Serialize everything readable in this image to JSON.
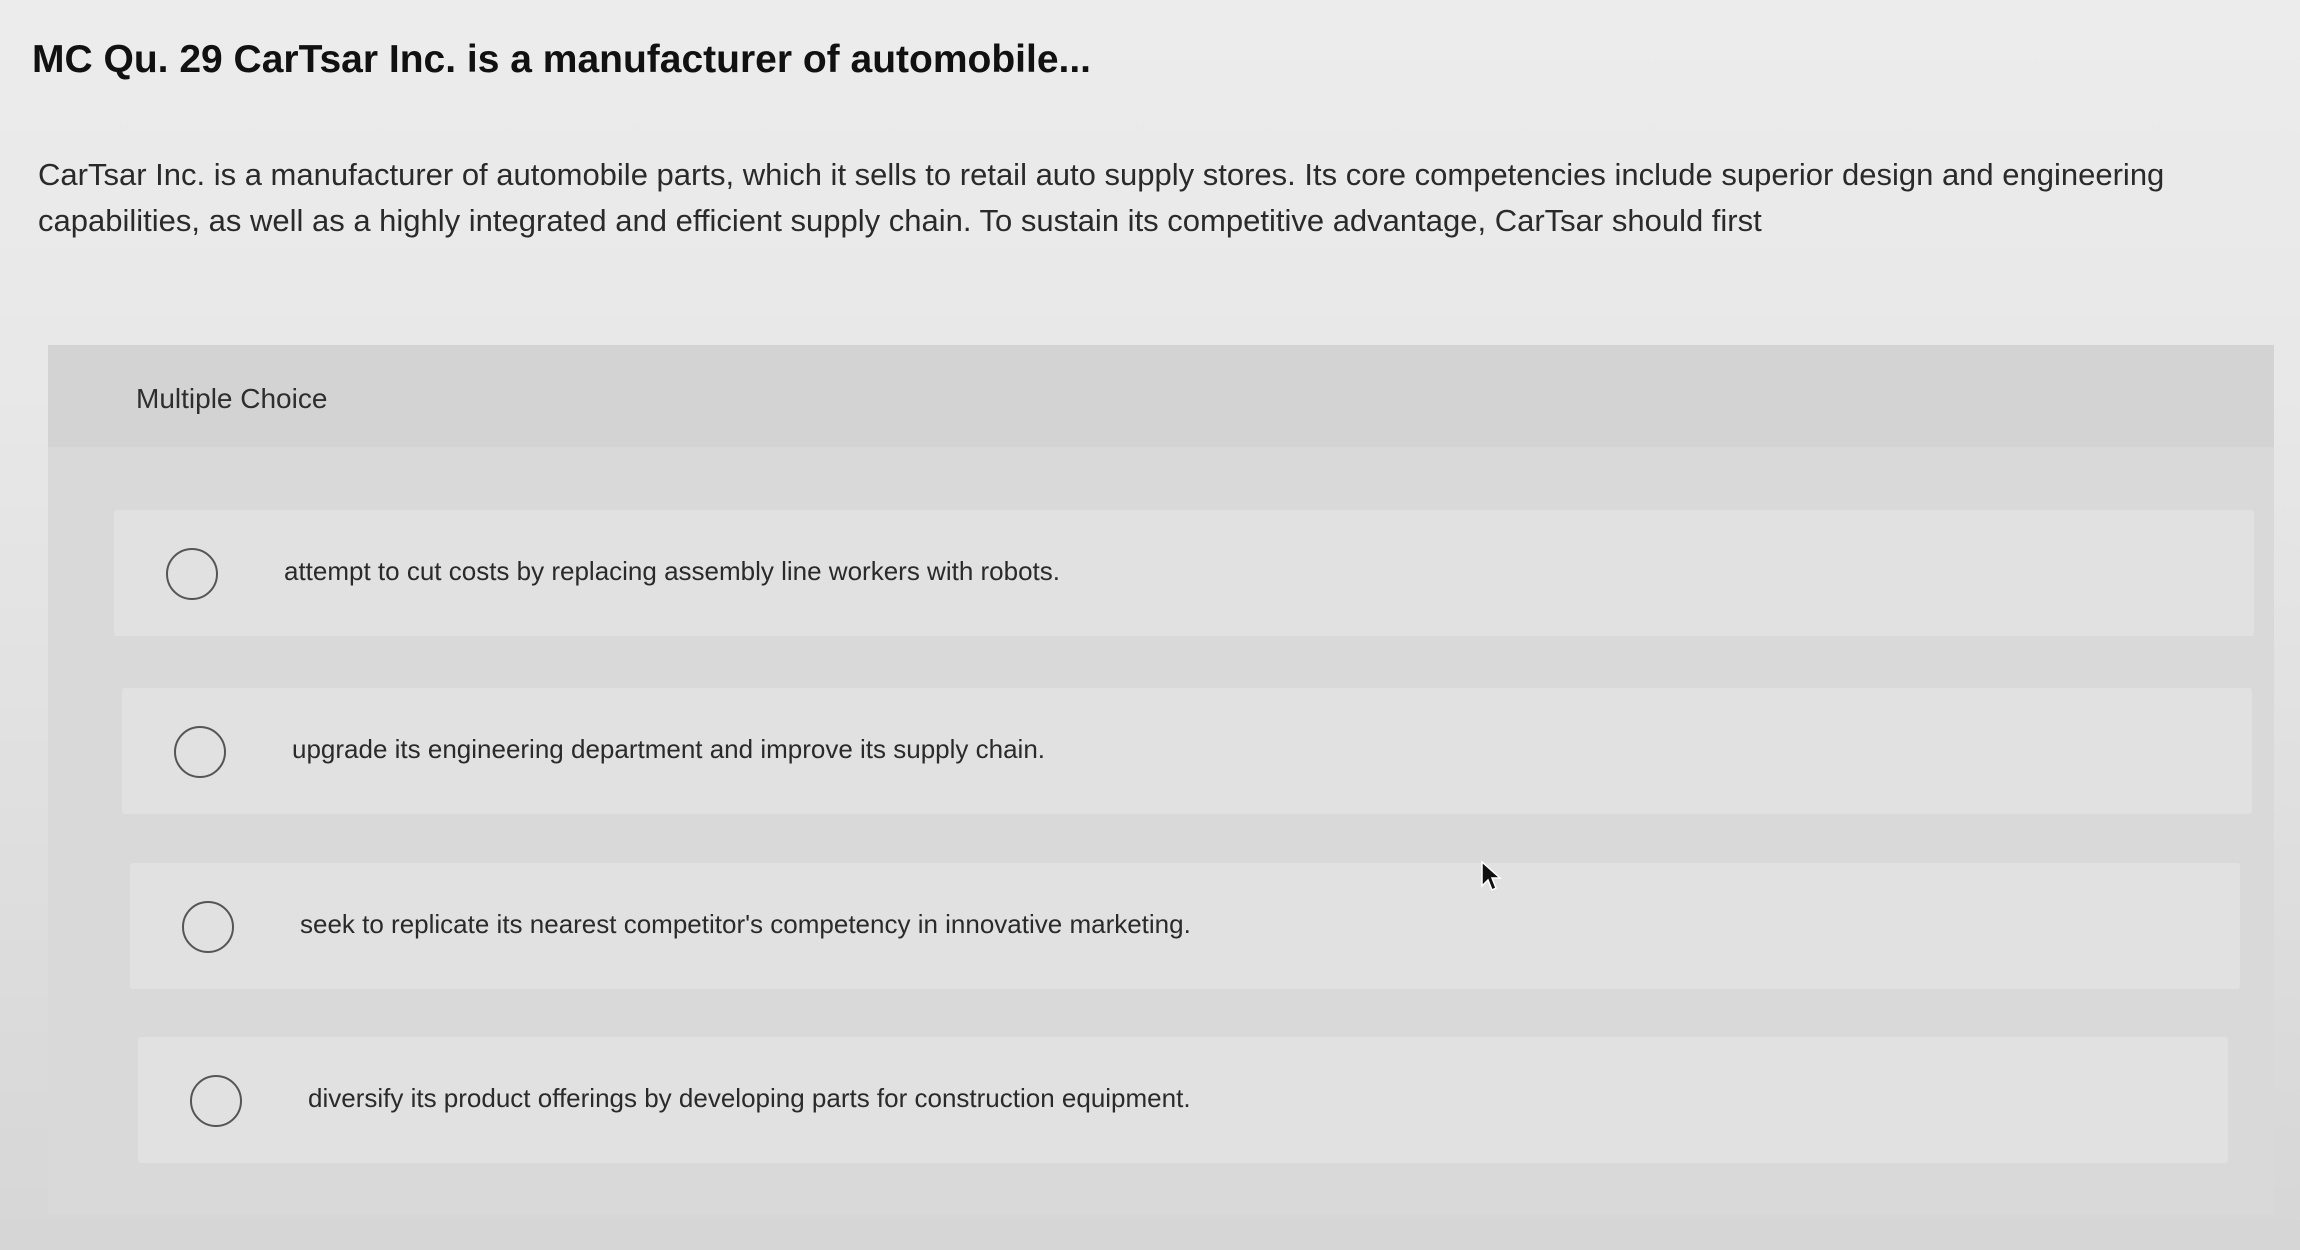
{
  "question": {
    "title": "MC Qu. 29 CarTsar Inc. is a manufacturer of automobile...",
    "body": "CarTsar Inc. is a manufacturer of automobile parts, which it sells to retail auto supply stores. Its core competencies include superior design and engineering capabilities, as well as a highly integrated and efficient supply chain. To sustain its competitive advantage, CarTsar should first"
  },
  "multiple_choice": {
    "label": "Multiple Choice",
    "options": [
      {
        "text": "attempt to cut costs by replacing assembly line workers with robots."
      },
      {
        "text": "upgrade its engineering department and improve its supply chain."
      },
      {
        "text": "seek to replicate its nearest competitor's competency in innovative marketing."
      },
      {
        "text": "diversify its product offerings by developing parts for construction equipment."
      }
    ]
  },
  "icons": {
    "radio": "radio-button-icon",
    "cursor": "mouse-pointer-icon"
  },
  "colors": {
    "panel_background": "#d9d9d9",
    "option_background": "#e1e1e1",
    "radio_border": "#555555"
  }
}
